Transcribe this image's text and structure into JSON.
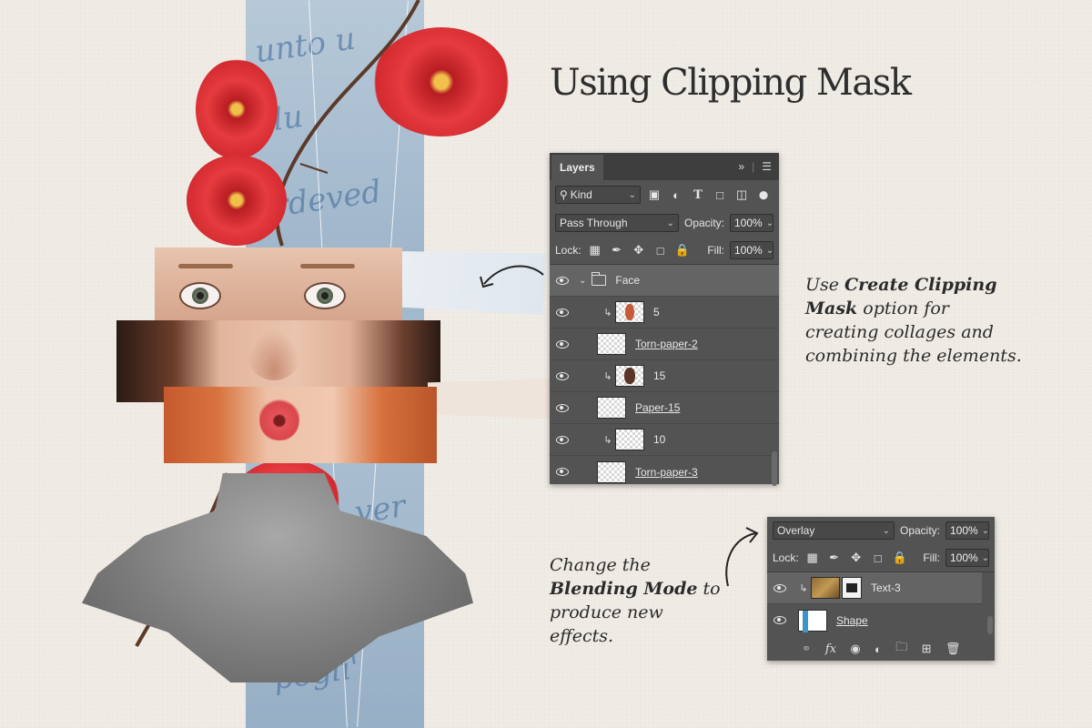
{
  "heading": "Using Clipping Mask",
  "caption_clipping": {
    "prefix": "Use ",
    "bold": "Create Clipping Mask",
    "suffix": " option for creating collages and combining the elements."
  },
  "caption_blending": {
    "prefix": "Change the ",
    "bold": "Blending Mode",
    "suffix": " to produce new effects."
  },
  "collage": {
    "script_lines": [
      "unto u",
      "lu",
      "erdeved",
      "ver",
      "pogli'"
    ]
  },
  "layers_panel": {
    "tab_label": "Layers",
    "title_icons": [
      "expand-icon",
      "menu-icon"
    ],
    "filter": {
      "label": "Kind"
    },
    "filter_icons": [
      "image-filter-icon",
      "adjustment-filter-icon",
      "type-filter-icon",
      "shape-filter-icon",
      "smart-object-filter-icon",
      "filter-toggle-icon"
    ],
    "blend_mode": "Pass Through",
    "opacity_label": "Opacity:",
    "opacity_value": "100%",
    "lock_label": "Lock:",
    "lock_icons": [
      "lock-transparent-icon",
      "lock-paint-icon",
      "lock-position-icon",
      "lock-artboard-icon",
      "lock-all-icon"
    ],
    "fill_label": "Fill:",
    "fill_value": "100%",
    "layers": [
      {
        "name": "Face",
        "type": "group",
        "active": true,
        "clipped": false,
        "linked": false
      },
      {
        "name": "5",
        "type": "image",
        "thumb": "face",
        "clipped": true,
        "linked": false
      },
      {
        "name": "Torn-paper-2",
        "type": "image",
        "thumb": "transparent",
        "clipped": false,
        "linked": true
      },
      {
        "name": "15",
        "type": "image",
        "thumb": "portrait",
        "clipped": true,
        "linked": false
      },
      {
        "name": "Paper-15",
        "type": "image",
        "thumb": "transparent",
        "clipped": false,
        "linked": true
      },
      {
        "name": "10",
        "type": "image",
        "thumb": "transparent",
        "clipped": true,
        "linked": false
      },
      {
        "name": "Torn-paper-3",
        "type": "image",
        "thumb": "transparent",
        "clipped": false,
        "linked": true
      }
    ]
  },
  "blend_panel": {
    "blend_mode": "Overlay",
    "opacity_label": "Opacity:",
    "opacity_value": "100%",
    "lock_label": "Lock:",
    "fill_label": "Fill:",
    "fill_value": "100%",
    "layers": [
      {
        "name": "Text-3",
        "thumb": "texture",
        "clipped": true,
        "linked": false,
        "active": true
      },
      {
        "name": "Shape",
        "thumb": "shape",
        "clipped": false,
        "linked": true,
        "active": false
      }
    ],
    "footer_icons": [
      "link-layers-icon",
      "fx-icon",
      "add-mask-icon",
      "adjustment-layer-icon",
      "new-group-icon",
      "new-layer-icon",
      "delete-layer-icon"
    ],
    "fx_label": "fx"
  },
  "colors": {
    "background": "#f1ede6",
    "panel": "#535353",
    "panel_dark": "#3e3e3e",
    "flower_red": "#e63b3f"
  }
}
